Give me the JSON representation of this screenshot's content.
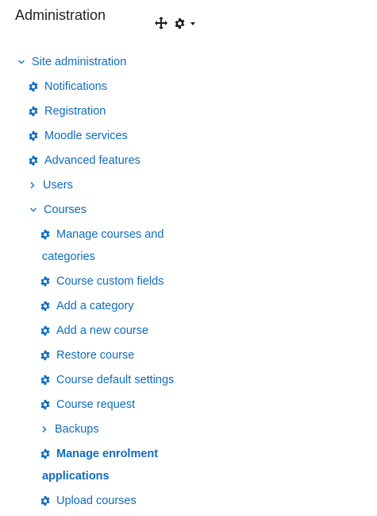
{
  "block": {
    "title": "Administration"
  },
  "tree": {
    "site_admin": "Site administration",
    "notifications": "Notifications",
    "registration": "Registration",
    "moodle_services": "Moodle services",
    "advanced_features": "Advanced features",
    "users": "Users",
    "courses": "Courses",
    "manage_courses_line1": "Manage courses and",
    "manage_courses_line2": "categories",
    "course_custom_fields": "Course custom fields",
    "add_category": "Add a category",
    "add_new_course": "Add a new course",
    "restore_course": "Restore course",
    "course_default_settings": "Course default settings",
    "course_request": "Course request",
    "backups": "Backups",
    "manage_enrolment_line1": "Manage enrolment",
    "manage_enrolment_line2": "applications",
    "upload_courses": "Upload courses"
  },
  "colors": {
    "link": "#0f6cbf",
    "text": "#1d2125"
  },
  "icons": {
    "move": "move-icon",
    "settings": "gear-icon",
    "dropdown": "caret-down-icon",
    "expanded": "chevron-down-icon",
    "collapsed": "chevron-right-icon",
    "item": "gear-icon"
  }
}
